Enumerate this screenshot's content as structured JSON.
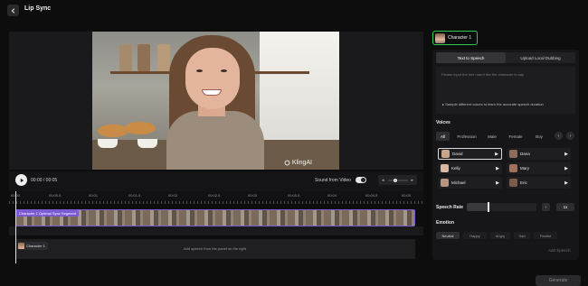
{
  "header": {
    "title": "Lip Sync"
  },
  "player": {
    "watermark": "KlingAI",
    "time": "00:00 / 00:05",
    "sound_label": "Sound from Video",
    "volume_low": "◂",
    "volume_high": "▸"
  },
  "timeline": {
    "ticks": [
      "00:00",
      "00:00.5",
      "00:01",
      "00:01.5",
      "00:02",
      "00:02.5",
      "00:03",
      "00:03.5",
      "00:04",
      "00:04.5",
      "00:05"
    ],
    "video_track_label": "Character 1 Optimal Sync Segment",
    "speech_track_character": "Character 1",
    "speech_track_hint": "Add speech from the panel on the right"
  },
  "right_panel": {
    "character_tab": "Character 1",
    "mode_tabs": [
      {
        "label": "Text to Speech",
        "active": true
      },
      {
        "label": "Upload Local Dubbing",
        "active": false
      }
    ],
    "script_placeholder": "Please input the text now'd like the character to say",
    "sample_hint": "Sample different voices to learn the accurate speech duration",
    "voices_title": "Voices",
    "filters": [
      {
        "label": "All",
        "active": true
      },
      {
        "label": "Profession",
        "active": false
      },
      {
        "label": "Male",
        "active": false
      },
      {
        "label": "Female",
        "active": false
      },
      {
        "label": "Boy",
        "active": false
      }
    ],
    "voices": [
      {
        "name": "David",
        "selected": true,
        "color": "#c7a58a"
      },
      {
        "name": "Dana",
        "selected": false,
        "color": "#8c6b5a"
      },
      {
        "name": "Kelly",
        "selected": false,
        "color": "#d8b8a2"
      },
      {
        "name": "Mary",
        "selected": false,
        "color": "#a0725c"
      },
      {
        "name": "Michael",
        "selected": false,
        "color": "#b59580"
      },
      {
        "name": "Eric",
        "selected": false,
        "color": "#7a5c4c"
      }
    ],
    "play_glyph": "▶",
    "speech_rate_title": "Speech Rate",
    "speech_rate": {
      "value": "1x",
      "level": 0.3,
      "decrease": "‹",
      "increase": "›"
    },
    "emotion_title": "Emotion",
    "emotions": [
      {
        "label": "Neutral",
        "active": true
      },
      {
        "label": "Happy",
        "active": false
      },
      {
        "label": "Angry",
        "active": false
      },
      {
        "label": "Sad",
        "active": false
      },
      {
        "label": "Fearful",
        "active": false
      }
    ],
    "add_speech": "Add Speech"
  },
  "footer": {
    "generate": "Generate"
  },
  "colors": {
    "accent_green": "#2ecc4e",
    "track_purple": "#7b5ad4"
  }
}
